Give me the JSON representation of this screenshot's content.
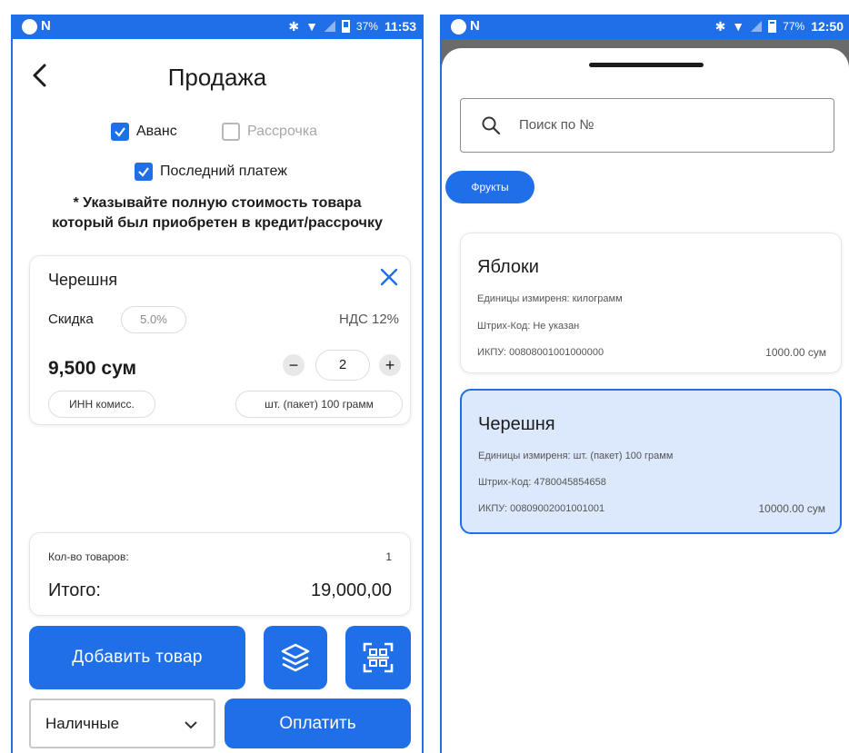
{
  "left_screen": {
    "status": {
      "time": "11:53",
      "battery": "37%",
      "app_letter": "N"
    },
    "title": "Продажа",
    "checkboxes": {
      "advance": {
        "label": "Аванс",
        "checked": true
      },
      "installment": {
        "label": "Рассрочка",
        "checked": false
      },
      "last_payment": {
        "label": "Последний платеж",
        "checked": true
      }
    },
    "notice": {
      "line1": "* Указывайте полную стоимость товара",
      "line2": "который был приобретен в кредит/рассрочку"
    },
    "item": {
      "name": "Черешня",
      "discount_label": "Скидка",
      "discount_value": "5.0%",
      "vat": "НДС 12%",
      "price": "9,500 сум",
      "quantity": "2",
      "minus": "−",
      "plus": "+",
      "inn_label": "ИНН комисс.",
      "unit": "шт. (пакет) 100 грамм"
    },
    "summary": {
      "count_label": "Кол-во товаров:",
      "count_value": "1",
      "total_label": "Итого:",
      "total_value": "19,000,00"
    },
    "buttons": {
      "add_item": "Добавить товар",
      "pay": "Оплатить"
    },
    "payment_method": "Наличные"
  },
  "right_screen": {
    "status": {
      "time": "12:50",
      "battery": "77%",
      "app_letter": "N"
    },
    "search_placeholder": "Поиск по №",
    "category_chip": "Фрукты",
    "products": [
      {
        "name": "Яблоки",
        "units": "Единицы измиреня: килограмм",
        "barcode": "Штрих-Код: Не указан",
        "ikpu": "ИКПУ: 00808001001000000",
        "price": "1000.00 сум",
        "selected": false
      },
      {
        "name": "Черешня",
        "units": "Единицы измиреня: шт. (пакет) 100 грамм",
        "barcode": "Штрих-Код: 4780045854658",
        "ikpu": "ИКПУ: 00809002001001001",
        "price": "10000.00 сум",
        "selected": true
      }
    ]
  },
  "colors": {
    "accent": "#1e6fe8",
    "selected_card": "#dce9fc"
  }
}
